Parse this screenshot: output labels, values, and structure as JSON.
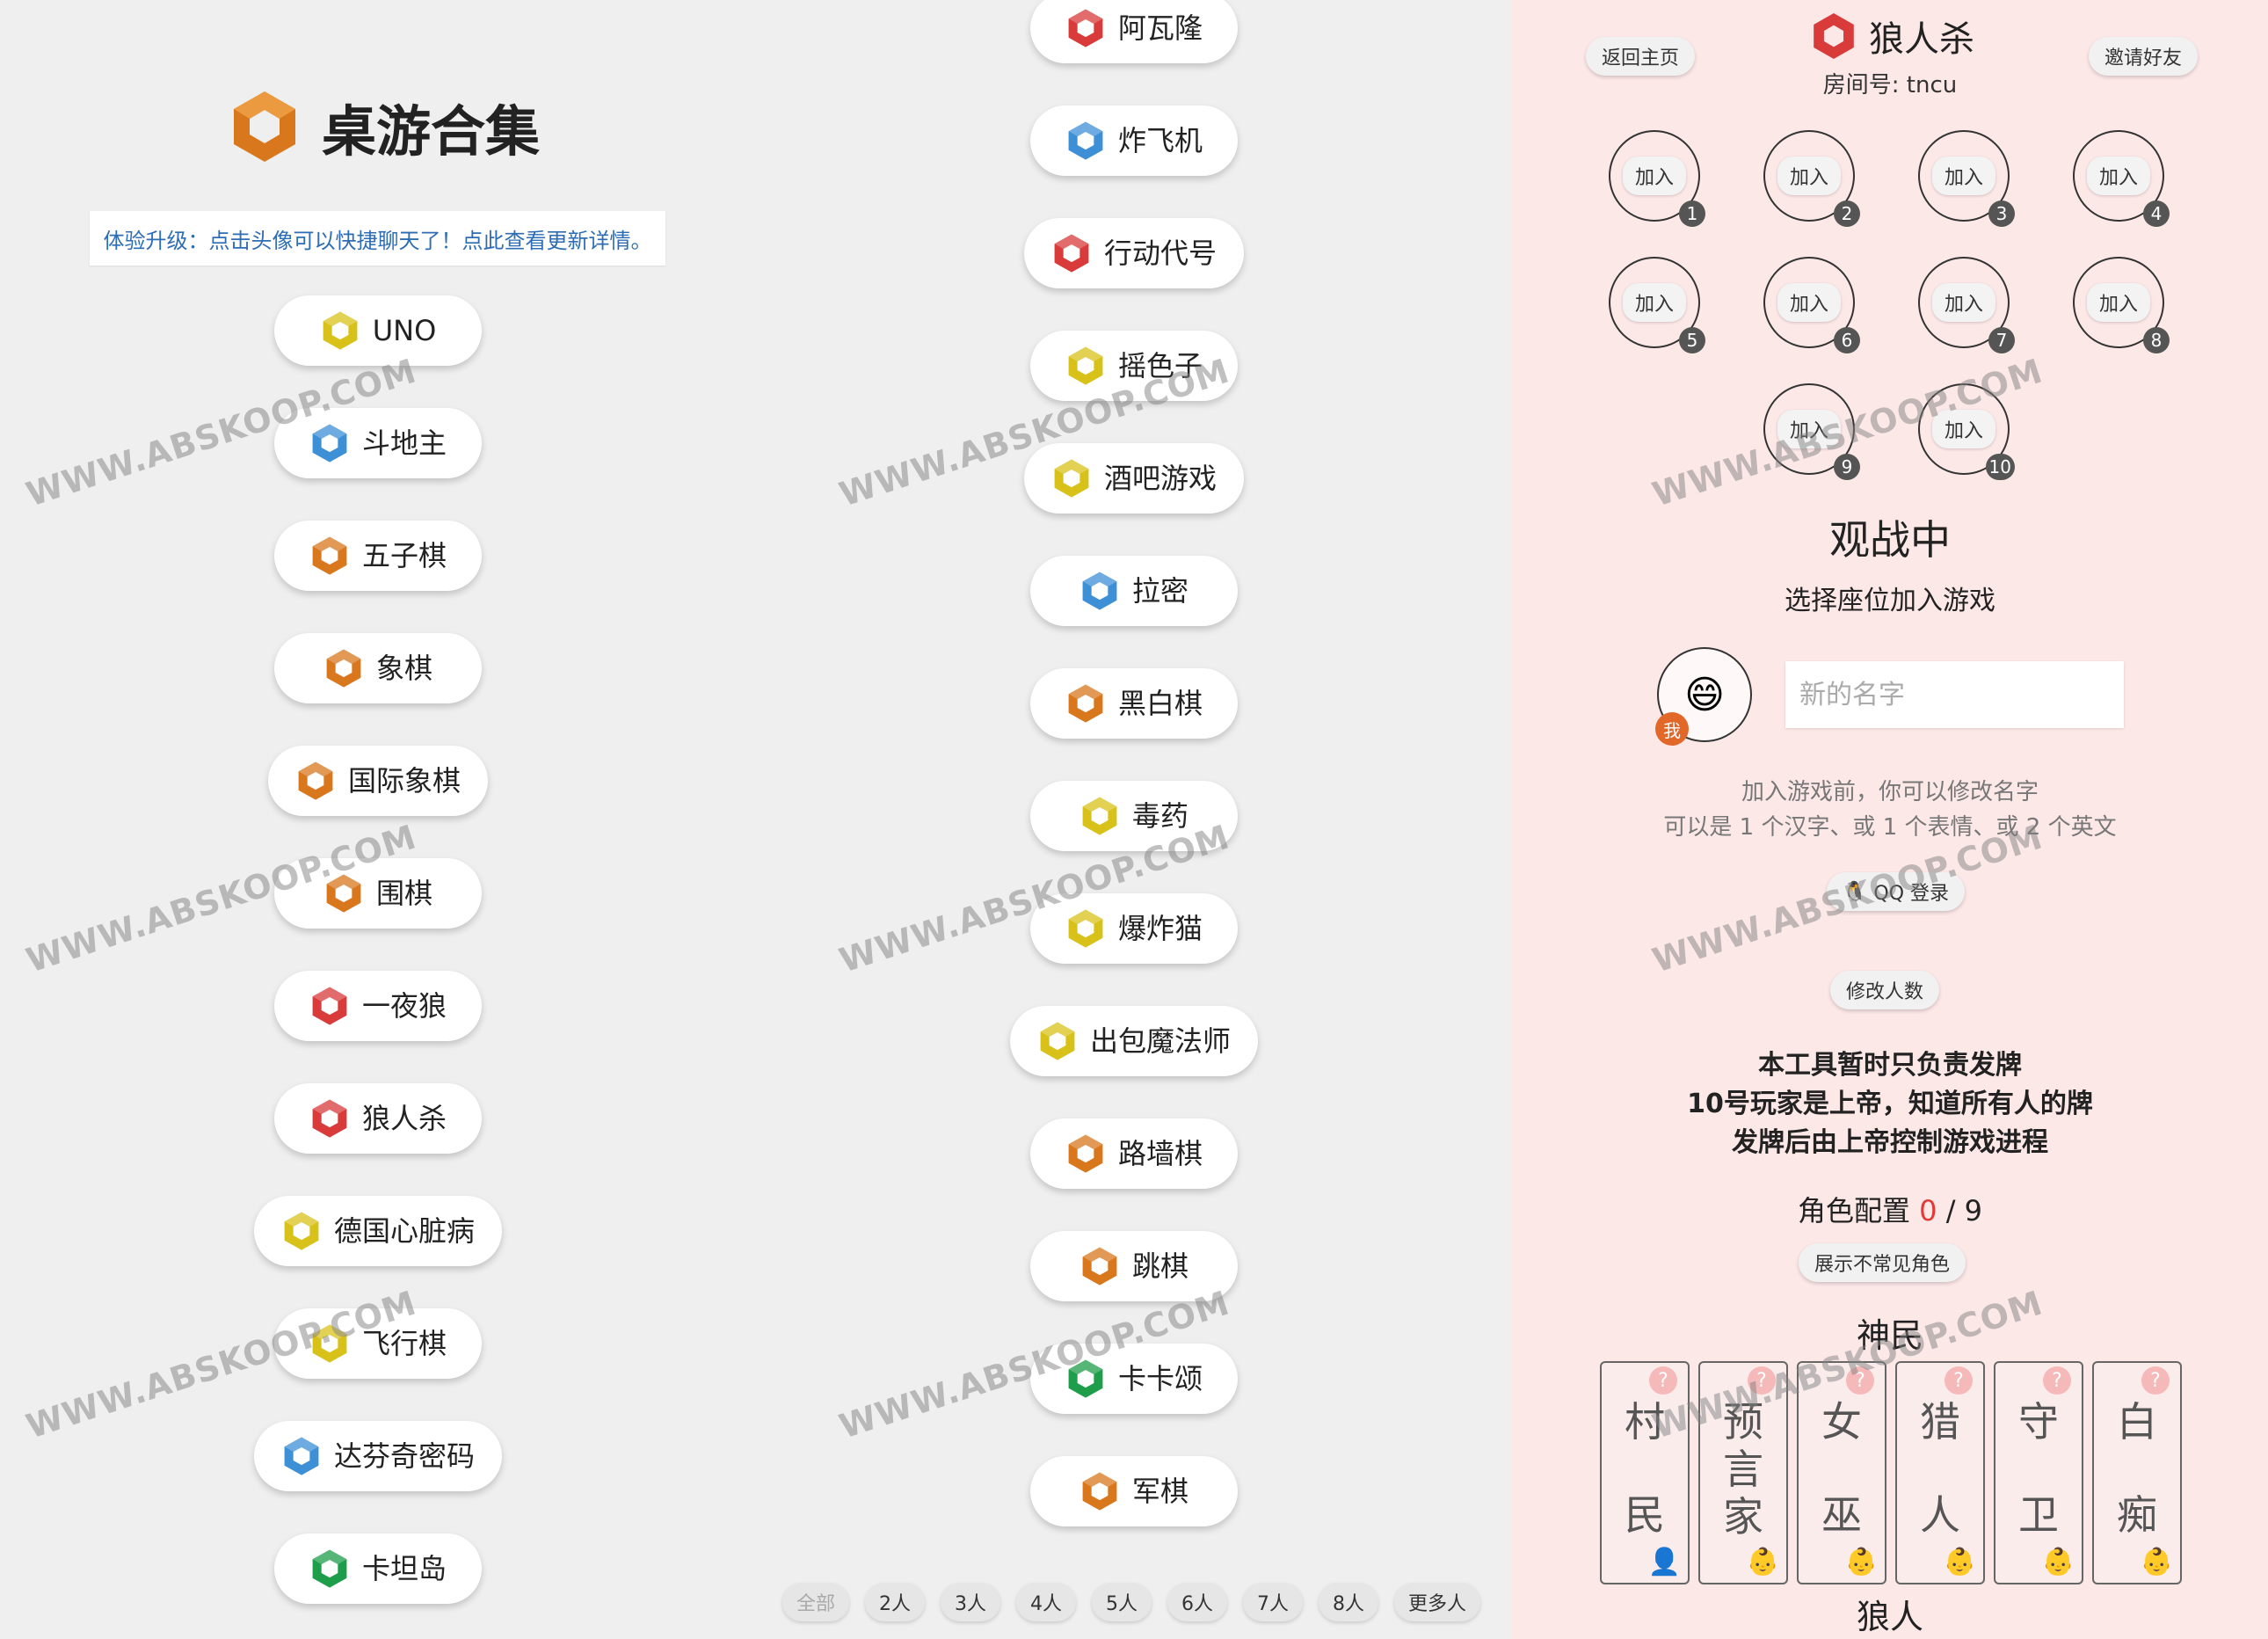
{
  "colors": {
    "orange": "#d9771c",
    "red": "#d93a3a",
    "blue": "#3d8fd6",
    "yellow": "#d8c21a",
    "green": "#1e9e4a",
    "accent_red": "#e53935"
  },
  "left": {
    "title": "桌游合集",
    "notice": "体验升级：点击头像可以快捷聊天了！点此查看更新详情。",
    "games": [
      {
        "name": "UNO",
        "icon": "yellow"
      },
      {
        "name": "斗地主",
        "icon": "blue"
      },
      {
        "name": "五子棋",
        "icon": "orange"
      },
      {
        "name": "象棋",
        "icon": "orange"
      },
      {
        "name": "国际象棋",
        "icon": "orange"
      },
      {
        "name": "围棋",
        "icon": "orange"
      },
      {
        "name": "一夜狼",
        "icon": "red"
      },
      {
        "name": "狼人杀",
        "icon": "red"
      },
      {
        "name": "德国心脏病",
        "icon": "yellow"
      },
      {
        "name": "飞行棋",
        "icon": "yellow"
      },
      {
        "name": "达芬奇密码",
        "icon": "blue"
      },
      {
        "name": "卡坦岛",
        "icon": "green"
      }
    ]
  },
  "mid": {
    "games": [
      {
        "name": "阿瓦隆",
        "icon": "red"
      },
      {
        "name": "炸飞机",
        "icon": "blue"
      },
      {
        "name": "行动代号",
        "icon": "red"
      },
      {
        "name": "摇色子",
        "icon": "yellow"
      },
      {
        "name": "酒吧游戏",
        "icon": "yellow"
      },
      {
        "name": "拉密",
        "icon": "blue"
      },
      {
        "name": "黑白棋",
        "icon": "orange"
      },
      {
        "name": "毒药",
        "icon": "yellow"
      },
      {
        "name": "爆炸猫",
        "icon": "yellow"
      },
      {
        "name": "出包魔法师",
        "icon": "yellow"
      },
      {
        "name": "路墙棋",
        "icon": "orange"
      },
      {
        "name": "跳棋",
        "icon": "orange"
      },
      {
        "name": "卡卡颂",
        "icon": "green"
      },
      {
        "name": "军棋",
        "icon": "orange"
      }
    ],
    "filters": [
      "全部",
      "2人",
      "3人",
      "4人",
      "5人",
      "6人",
      "7人",
      "8人",
      "更多人"
    ]
  },
  "right": {
    "back_home": "返回主页",
    "invite": "邀请好友",
    "game_title": "狼人杀",
    "room_label": "房间号: tncu",
    "join_label": "加入",
    "seats": [
      "1",
      "2",
      "3",
      "4",
      "5",
      "6",
      "7",
      "8",
      "9",
      "10"
    ],
    "status": "观战中",
    "status_sub": "选择座位加入游戏",
    "avatar_emoji": "😄",
    "me_badge": "我",
    "name_placeholder": "新的名字",
    "hint1": "加入游戏前，你可以修改名字",
    "hint2": "可以是 1 个汉字、或 1 个表情、或 2 个英文",
    "qq_login": "QQ 登录",
    "change_count": "修改人数",
    "info1": "本工具暂时只负责发牌",
    "info2": "10号玩家是上帝，知道所有人的牌",
    "info3": "发牌后由上帝控制游戏进程",
    "role_config_label": "角色配置",
    "role_config_current": "0",
    "role_config_total": "/ 9",
    "show_rare": "展示不常见角色",
    "group_villager": "神民",
    "group_wolf": "狼人",
    "roles": [
      {
        "chars": [
          "村",
          "民"
        ],
        "face": "👤"
      },
      {
        "chars": [
          "预",
          "言",
          "家"
        ],
        "face": "👶"
      },
      {
        "chars": [
          "女",
          "巫"
        ],
        "face": "👶"
      },
      {
        "chars": [
          "猎",
          "人"
        ],
        "face": "👶"
      },
      {
        "chars": [
          "守",
          "卫"
        ],
        "face": "👶"
      },
      {
        "chars": [
          "白",
          "痴"
        ],
        "face": "👶"
      }
    ],
    "role_q": "?"
  },
  "watermark": "WWW.ABSKOOP.COM"
}
